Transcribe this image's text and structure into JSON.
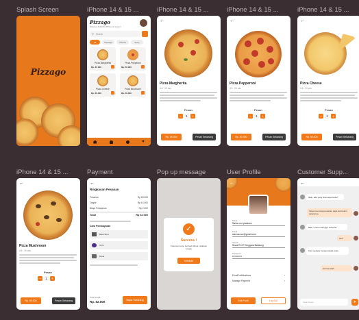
{
  "frames": {
    "f1": {
      "label": "Splash Screen",
      "logo": "Pizzago"
    },
    "f2": {
      "label": "iPhone 14 & 15 ...",
      "logo": "Pizzago",
      "subtitle": "Discover Authentic Pizza and enjoy it",
      "search_placeholder": "Search",
      "categories": [
        "All",
        "Sausage",
        "Cheese",
        "Spicy"
      ],
      "products": [
        {
          "name": "Pizza Margherita",
          "price": "Rp. 45.000"
        },
        {
          "name": "Pizza Pepperoni",
          "price": "Rp. 50.000"
        },
        {
          "name": "Pizza Cheese",
          "price": "Rp. 55.000"
        },
        {
          "name": "Pizza Mushroom",
          "price": "Rp. 50.000"
        }
      ],
      "nav_icons": [
        "home-icon",
        "user-icon",
        "chat-icon",
        "heart-icon"
      ]
    },
    "f3": {
      "label": "iPhone 14 & 15 ...",
      "title": "Pizza Margherita",
      "meta": "4.8 · 20 min",
      "qty_label": "Pesan",
      "qty": "1",
      "price": "Rp. 45.000",
      "order": "Pesan Sekarang"
    },
    "f4": {
      "label": "iPhone 14 & 15 ...",
      "title": "Pizza Pepperoni",
      "meta": "4.9 · 20 min",
      "qty_label": "Pesan",
      "qty": "1",
      "price": "Rp. 50.000",
      "order": "Pesan Sekarang"
    },
    "f5": {
      "label": "iPhone 14 & 15 ...",
      "title": "Pizza Cheese",
      "meta": "4.8 · 20 min",
      "qty_label": "Pesan",
      "qty": "1",
      "price": "Rp. 55.000",
      "order": "Pesan Sekarang"
    },
    "f6": {
      "label": "iPhone 14 & 15 ...",
      "title": "Pizza Mushroom",
      "meta": "4.9 · 20 min",
      "qty_label": "Pesan",
      "qty": "1",
      "price": "Rp. 50.000",
      "order": "Pesan Sekarang"
    },
    "f7": {
      "label": "Payment",
      "heading": "Ringkasan Pesanan",
      "rows": [
        {
          "k": "Pesanan",
          "v": "Rp 50.000"
        },
        {
          "k": "Ongkir",
          "v": "Rp 10.000"
        },
        {
          "k": "Biaya Pelayanan",
          "v": "Rp 2.000"
        }
      ],
      "total_label": "Total",
      "total": "Rp 62.000",
      "methods_heading": "Cara Pembayaran",
      "methods": [
        "Bank BCA",
        "OVO",
        "Dana"
      ],
      "footer_label": "Total Harga",
      "footer_total": "Rp. 62.000",
      "pay_button": "Bayar Sekarang"
    },
    "f8": {
      "label": "Pop up message",
      "title": "Success !",
      "message": "Pesanan kamu berhasil dibuat, silahkan tunggu",
      "button": "Kembali"
    },
    "f9": {
      "label": "User Profile",
      "fields": [
        {
          "label": "Nama",
          "value": "Salma nur prabowo"
        },
        {
          "label": "Email",
          "value": "salmaa.nur@gmail.com"
        },
        {
          "label": "Alamat",
          "value": "Sewa Rt 07 Tenggara Bandung"
        },
        {
          "label": "Password",
          "value": "••••••••••••"
        }
      ],
      "links": [
        "Email Notifications",
        "Manage Payment"
      ],
      "left_button": "Edit Profil",
      "right_button": "Log Out"
    },
    "f10": {
      "label": "Customer Supp...",
      "messages": [
        "Halo, ada yang bisa saya bantu?",
        "Saya mau tanya pesanan saya kok belum sampai ya",
        "Baik, mohon ditunggu sebentar",
        "Oke",
        "Kurir sedang menuju lokasi anda",
        "Terima kasih"
      ],
      "input_placeholder": "Ketik Pesan"
    }
  }
}
